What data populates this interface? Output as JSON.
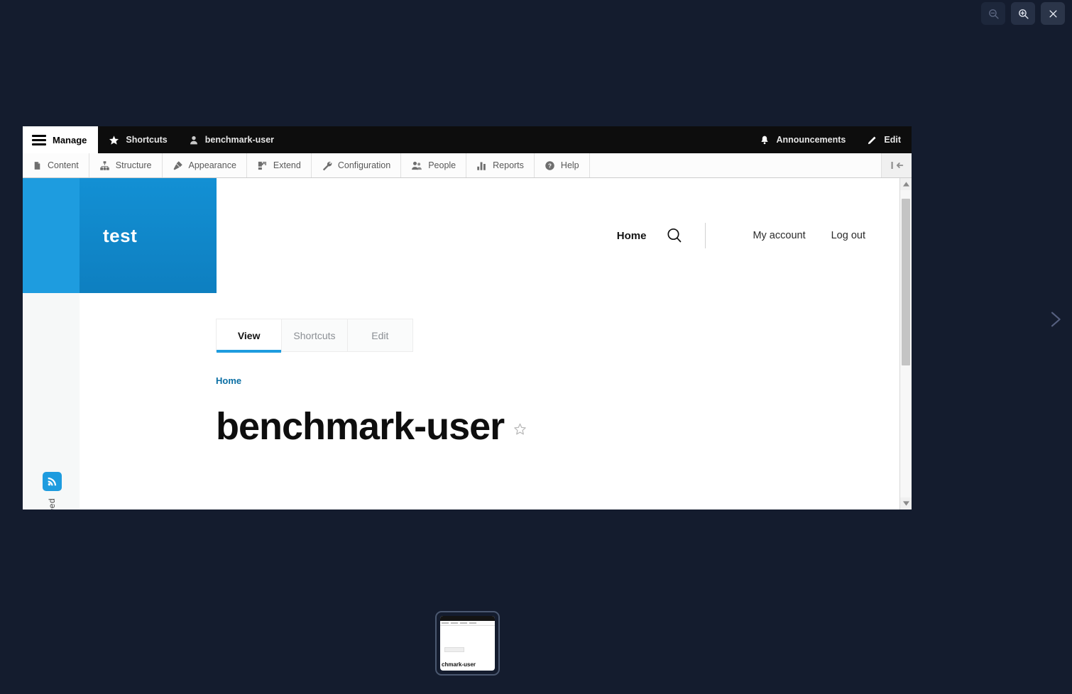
{
  "window_controls": {
    "zoom_out": "zoom-out",
    "zoom_in": "zoom-in",
    "close": "close"
  },
  "nav": {
    "next": "next"
  },
  "admin_toolbar": {
    "manage": "Manage",
    "shortcuts": "Shortcuts",
    "user": "benchmark-user",
    "announcements": "Announcements",
    "edit": "Edit",
    "tray_items": [
      {
        "label": "Content",
        "icon": "content-icon"
      },
      {
        "label": "Structure",
        "icon": "structure-icon"
      },
      {
        "label": "Appearance",
        "icon": "appearance-icon"
      },
      {
        "label": "Extend",
        "icon": "extend-icon"
      },
      {
        "label": "Configuration",
        "icon": "configuration-icon"
      },
      {
        "label": "People",
        "icon": "people-icon"
      },
      {
        "label": "Reports",
        "icon": "reports-icon"
      },
      {
        "label": "Help",
        "icon": "help-icon"
      }
    ],
    "tray_toggle": "tray-orientation-toggle"
  },
  "site_header": {
    "logo_text": "test",
    "home": "Home",
    "search": "search",
    "my_account": "My account",
    "log_out": "Log out"
  },
  "sidebar": {
    "rss_label": "RSS feed",
    "rss_icon": "rss-icon"
  },
  "main": {
    "tabs": [
      {
        "label": "View",
        "active": true
      },
      {
        "label": "Shortcuts",
        "active": false
      },
      {
        "label": "Edit",
        "active": false
      }
    ],
    "breadcrumb": "Home",
    "title": "benchmark-user",
    "star": "star-outline-icon"
  },
  "scrollbar": {
    "up": "scroll-up",
    "down": "scroll-down"
  },
  "thumbnail": {
    "title": "chmark-user"
  },
  "colors": {
    "background": "#141c2e",
    "toolbar_dark": "#0d0d0d",
    "accent_blue": "#1e9cdf",
    "logo_blue": "#0e7fc0",
    "link_blue": "#0b6fa4"
  }
}
